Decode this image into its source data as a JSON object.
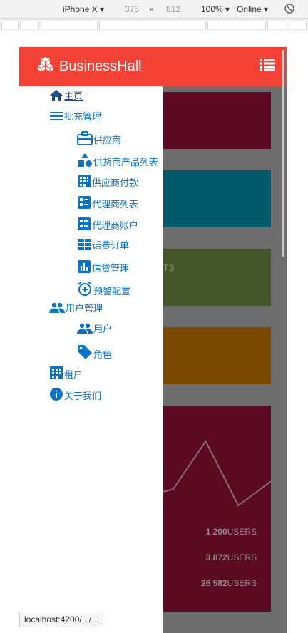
{
  "devtools": {
    "device": "iPhone X",
    "width": "375",
    "times": "×",
    "height": "812",
    "zoom": "100%",
    "network": "Online"
  },
  "header": {
    "brand": "BusinessHall"
  },
  "nav": {
    "home": "主页",
    "batch": "批充管理",
    "supplier": "供应商",
    "supplier_products": "供货商产品列表",
    "supplier_payment": "供应商付款",
    "agent_list": "代理商列表",
    "agent_account": "代理商账户",
    "phone_orders": "话费订单",
    "credit": "信贷管理",
    "alerts": "预警配置",
    "users_mgmt": "用户管理",
    "users": "用户",
    "roles": "角色",
    "tenant": "租户",
    "about": "关于我们"
  },
  "dashboard": {
    "faint_label": "TS",
    "stats": [
      {
        "value": "1 200",
        "unit": "USERS"
      },
      {
        "value": "3 872",
        "unit": "USERS"
      },
      {
        "value": "26 582",
        "unit": "USERS"
      }
    ],
    "chart_data": {
      "type": "line",
      "title": "",
      "xlabel": "",
      "ylabel": "",
      "series": [
        {
          "values": [
            1,
            2,
            8,
            0,
            3
          ]
        }
      ]
    }
  },
  "colors": {
    "appbar": "#f44336",
    "card1": "#5c0a24",
    "card2": "#005a6a",
    "card3": "#44562a",
    "card4": "#7a4a00",
    "card5": "#5c0a24",
    "nav_text": "#0b73c6"
  },
  "statusbar": {
    "url": "localhost:4200/.../..."
  }
}
